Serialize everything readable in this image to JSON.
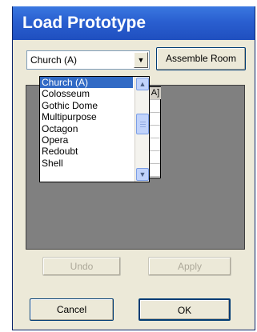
{
  "window": {
    "title": "Load Prototype"
  },
  "prototype_select": {
    "value": "Church (A)",
    "options": [
      "Church (A)",
      "Colosseum",
      "Gothic Dome",
      "Multipurpose",
      "Octagon",
      "Opera",
      "Redoubt",
      "Shell"
    ],
    "selected_index": 0
  },
  "buttons": {
    "assemble": "Assemble Room",
    "undo": "Undo",
    "apply": "Apply",
    "cancel": "Cancel",
    "ok": "OK"
  },
  "grid_header": "A]",
  "colors": {
    "title_bar": "#2a5fd0",
    "selection": "#316ac5",
    "preview_background": "#808080",
    "dialog_background": "#ece9d8"
  }
}
